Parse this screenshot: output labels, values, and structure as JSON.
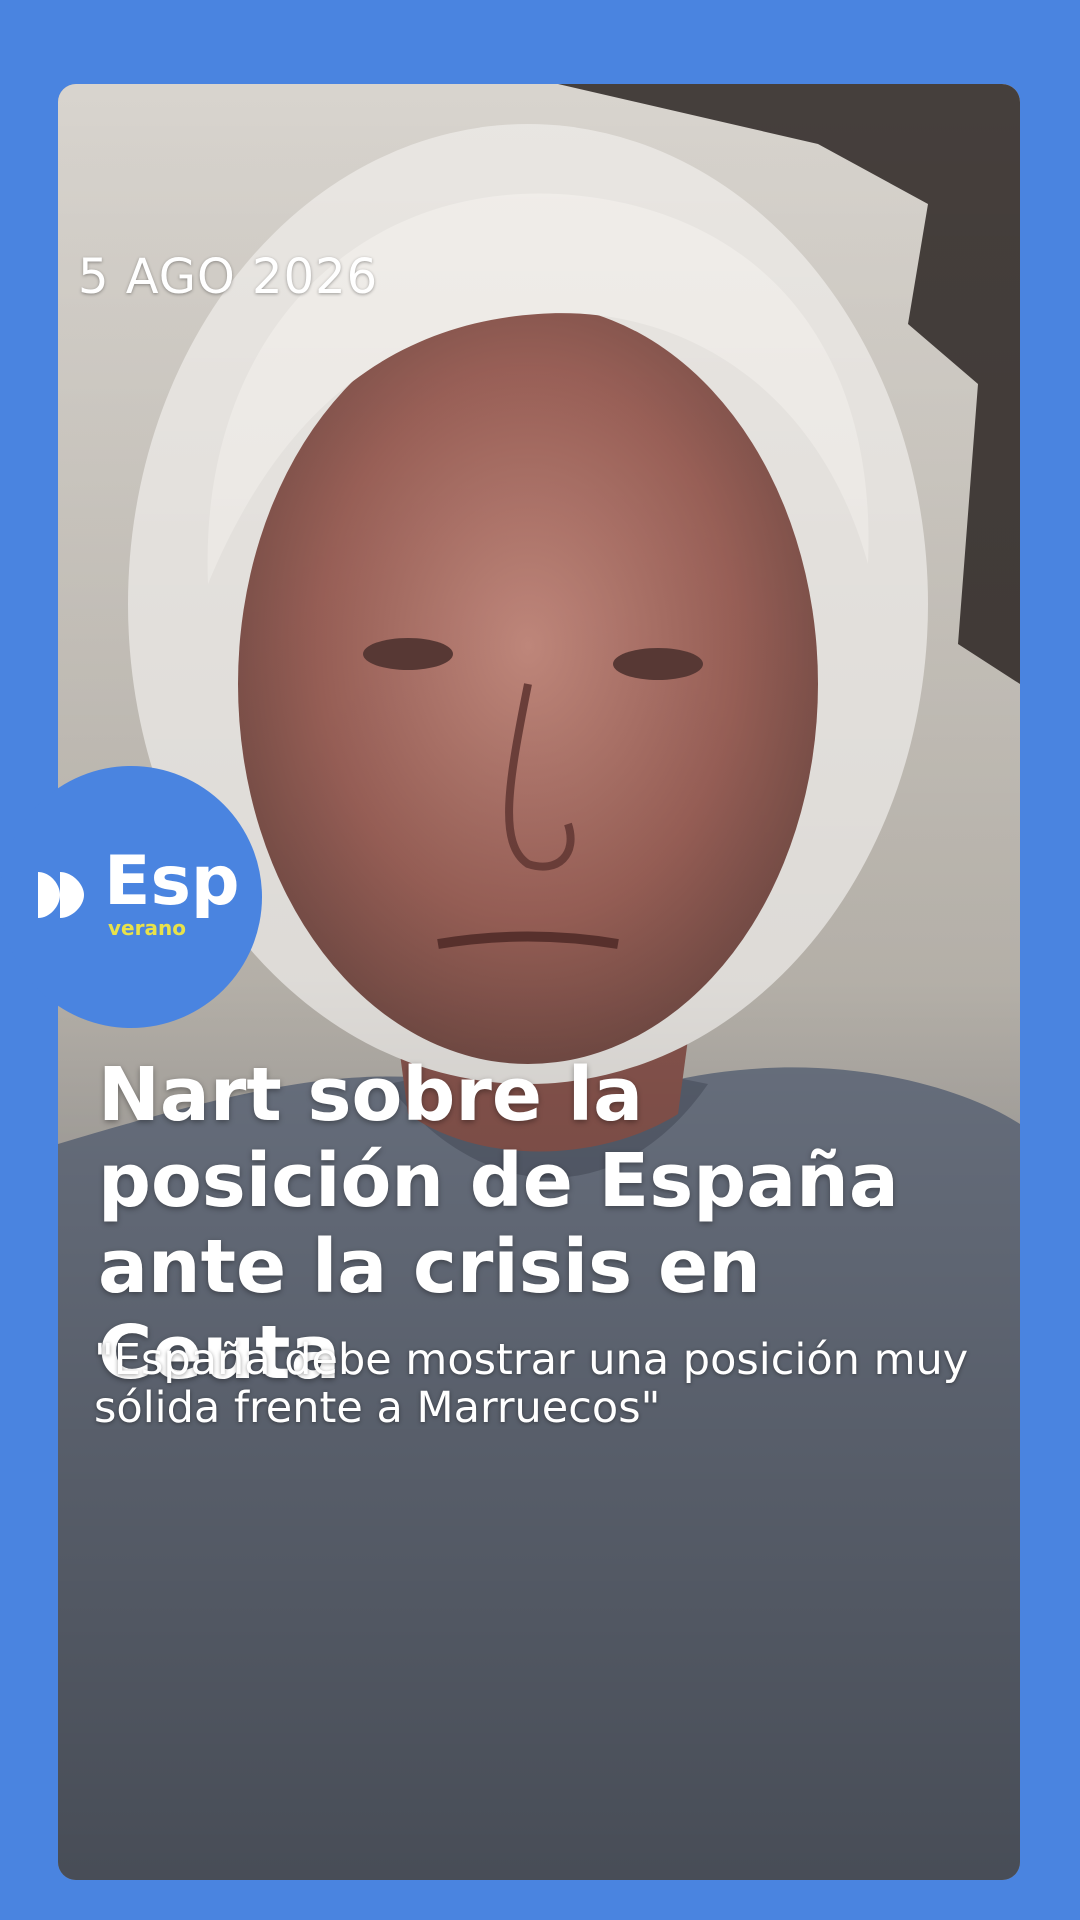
{
  "story": {
    "date": "5 AGO 2026",
    "headline": "Nart sobre la posición de España ante la crisis en Ceuta",
    "quote": "\"España debe mostrar una posición muy sólida frente a Marruecos\""
  },
  "logo": {
    "brand": "Esp",
    "sub": "verano",
    "icon": "double-chevron-play-icon"
  },
  "colors": {
    "frame": "#4a84e0",
    "accent_sub": "#e8e24a",
    "text": "#ffffff"
  }
}
